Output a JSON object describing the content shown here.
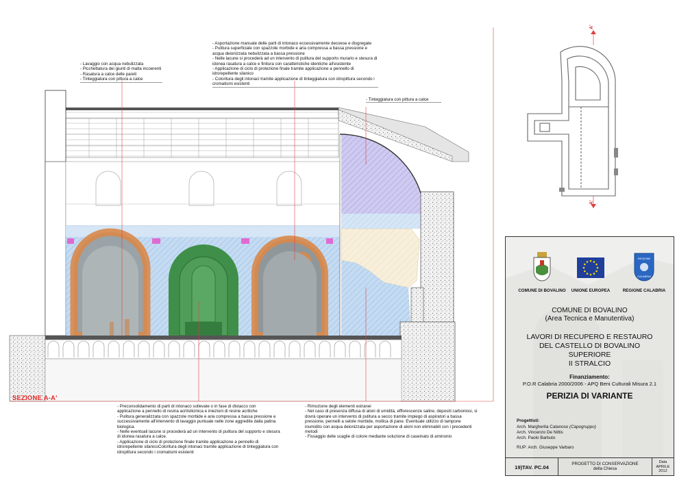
{
  "section_label": "SEZIONE A-A'",
  "section_marks": {
    "top": "A'",
    "bottom": "A'"
  },
  "notes": {
    "top_left": [
      "- Lavaggio con acqua nebulizzata",
      "- Picchettatura dei giunti di malta incoerenti",
      "- Rasatura a calce delle pareti",
      "- Tinteggiatura con pittura a calce"
    ],
    "top_center": [
      "- Asportazione manuale delle parti di intonaco eccessivamente decoese e disgregate",
      "- Pulitura superficiale con spazzole morbide e aria compressa a bassa pressione e acqua deionizzata nebulizzata a bassa pressione",
      "- Nelle lacune si procederà ad un intervento di pulitura del supporto murario e stesura di idonea rasatura a calce e finitura con caratteristiche identiche all'esistente",
      "- Applicazione di ciclo di protezione finale tramite applicazione a pennello di idrorepellente silanico",
      "- Coloritura degli intonaci tramite applicazione di tinteggiatura con idropittura secondo i cromatismi esistenti"
    ],
    "top_right": [
      "- Tinteggiatura con pittura a calce"
    ],
    "bottom_left": [
      "- Preconsolidamento di parti di intonaco sollevate o in fase di distacco con applicazione a pennello di resina acrilsilicinica e iniezioni di resine acriliche",
      "- Pulitura generalizzata con spazzole morbide e aria compressa a bassa pressione e successivamente all'intervento di lavaggio puntuale nelle zone aggredite dalla patina biologica.",
      "- Nelle eventuali lacune si procederà ad un intervento di pulitura del supporto e stesura di idonea rasatura a calce.",
      "- Applicazione di ciclo di protezione finale tramite applicazione a pennello di idrorepellente silanicoColoritura degli intonaci tramite applicazione di tinteggiatura con idropittura secondo i cromatismi esistenti"
    ],
    "bottom_right": [
      "- Rimozione degli elementi estranei",
      "- Nel caso di presenza diffusa di aloni di umidità, efflorescenze saline, depositi carboniosi, si dovrà operare un intervento di pulitura a secco tramite impiego di aspiratori a bassa pressione, pennelli a setole morbide, mollica di pane. Eventuale utilizzo di tampone inumidito con acqua deionizzata per asportazione di aloni non eliminabili con i precedenti metodi",
      "- Fissaggio delle scaglie di colore mediante soluzione di caseinato di aminonio"
    ]
  },
  "title_block": {
    "logos": [
      {
        "caption": "COMUNE DI BOVALINO",
        "icon": "comune-crest-icon"
      },
      {
        "caption": "UNIONE EUROPEA",
        "icon": "eu-flag-icon"
      },
      {
        "caption": "REGIONE CALABRIA",
        "icon": "regione-calabria-shield-icon"
      }
    ],
    "shield_text": [
      "REGIONE",
      "CALABRIA"
    ],
    "authority": [
      "COMUNE DI BOVALINO",
      "(Area Tecnica e Manutentiva)"
    ],
    "project": [
      "LAVORI DI RECUPERO E RESTAURO",
      "DEL CASTELLO DI BOVALINO",
      "SUPERIORE",
      "II STRALCIO"
    ],
    "funding_label": "Finanziamento:",
    "funding_text": "P.O.R Calabria 2000/2006 - APQ Beni Culturali Misura 2.1",
    "document_title": "PERIZIA DI VARIANTE",
    "designers_label": "Progettisti:",
    "designers": [
      {
        "name": "Arch. Margherita Catanoso",
        "role": "(Capogruppo)"
      },
      {
        "name": "Arch. Vincenzo De Nittis",
        "role": ""
      },
      {
        "name": "Arch. Paolo Barbuto",
        "role": ""
      }
    ],
    "rup": "RUP: Arch. Giuseppe Varbaro",
    "sheet_code": "19)TAV. PC.04",
    "sheet_title": [
      "PROGETTO DI CONSERVAZIONE",
      "della Chiesa"
    ],
    "date_label": "Data",
    "date_value": [
      "APRILE",
      "2012"
    ]
  },
  "colors": {
    "annotation_red": "#e04040",
    "lime_plaster_blue": "#b9d3ee",
    "vault_lavender": "#c9c6ee",
    "fresco_green": "#3f8f4a",
    "consolidation_orange": "#d9884a",
    "cream_plaster": "#f6ecd6",
    "eu_blue": "#1f3f9a",
    "calabria_blue": "#2a67c2"
  }
}
